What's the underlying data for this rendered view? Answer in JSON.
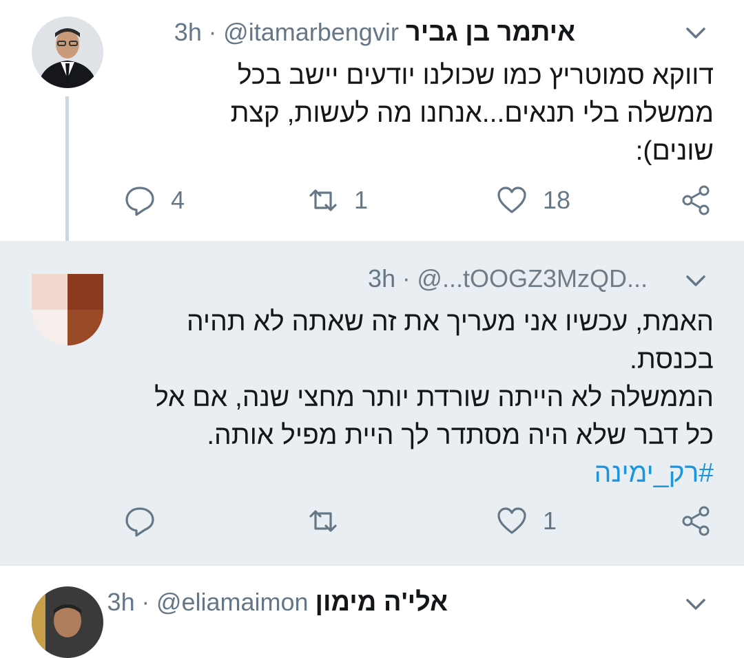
{
  "tweets": [
    {
      "name": "איתמר בן גביר",
      "handle": "@itamarbengvir",
      "separator": "·",
      "time": "3h",
      "lines": [
        "דווקא סמוטריץ כמו שכולנו יודעים יישב בכל",
        "ממשלה בלי תנאים...אנחנו מה לעשות, קצת",
        "שונים):"
      ],
      "actions": {
        "replies": "4",
        "retweets": "1",
        "likes": "18"
      }
    },
    {
      "name": "",
      "handle": "@...tOOGZ3MzQD...",
      "separator": "·",
      "time": "3h",
      "lines": [
        "האמת, עכשיו אני מעריך את זה שאתה לא תהיה",
        "בכנסת.",
        "הממשלה לא הייתה שורדת יותר מחצי שנה, אם אל",
        "כל דבר שלא היה מסתדר לך היית מפיל אותה."
      ],
      "hashtag": "#רק_ימינה",
      "actions": {
        "replies": "",
        "retweets": "",
        "likes": "1"
      }
    },
    {
      "name": "אלי'ה מימון",
      "handle": "@eliamaimon",
      "separator": "·",
      "time": "3h"
    }
  ],
  "colors": {
    "text": "#14171a",
    "secondary": "#657786",
    "link": "#1b95e0",
    "highlight_bg": "#e8eef2",
    "thread_line": "#ccd6dd"
  },
  "icons": {
    "reply": "reply-icon",
    "retweet": "retweet-icon",
    "like": "heart-icon",
    "share": "share-icon",
    "menu": "chevron-down-icon"
  }
}
